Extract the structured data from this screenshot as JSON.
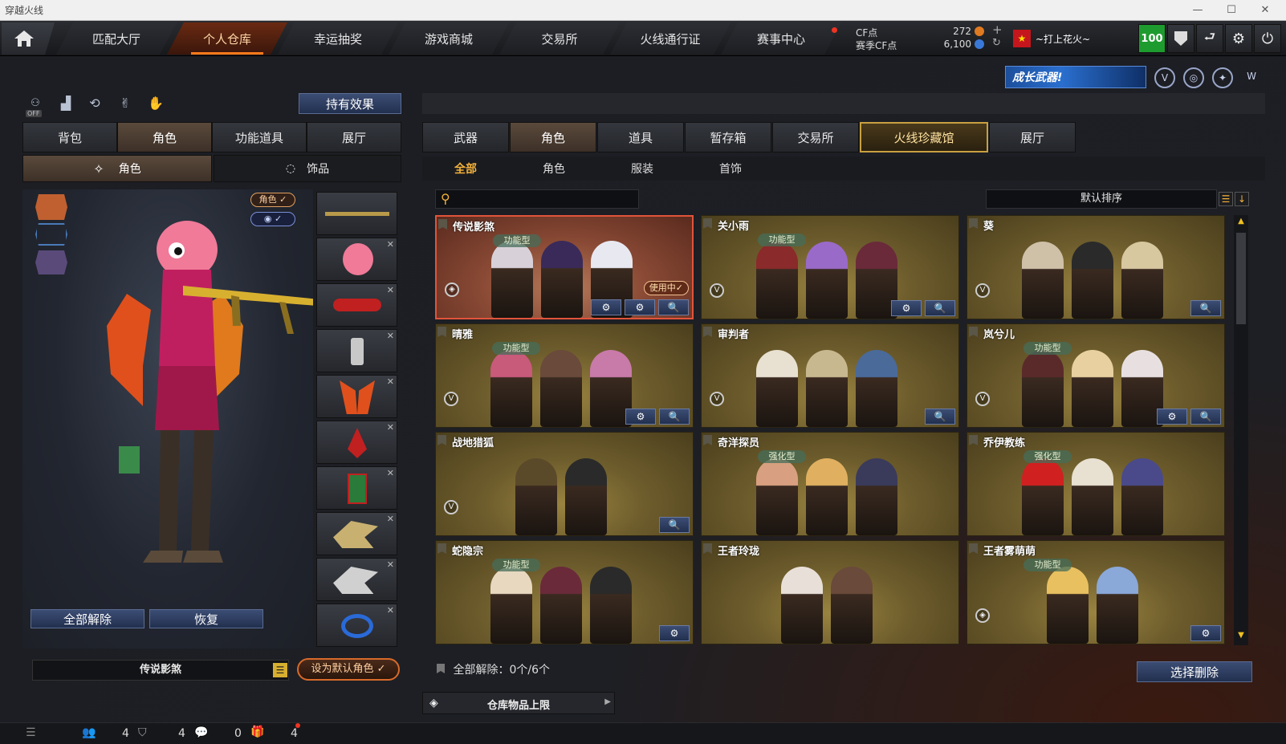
{
  "window": {
    "title": "穿越火线",
    "min": "—",
    "max": "☐",
    "close": "✕"
  },
  "nav": {
    "home_icon": "home-icon",
    "tabs": [
      "匹配大厅",
      "个人仓库",
      "幸运抽奖",
      "游戏商城",
      "交易所",
      "火线通行证",
      "赛事中心"
    ],
    "active": "个人仓库"
  },
  "currency": {
    "cf_label": "CF点",
    "cf_value": "272",
    "season_label": "赛季CF点",
    "season_value": "6,100"
  },
  "user": {
    "flag": "★",
    "name": "~打上花火~",
    "level": "100"
  },
  "banner": {
    "text": "成长武器!"
  },
  "left": {
    "hold_effect": "持有效果",
    "off_label": "OFF",
    "tabs": [
      "背包",
      "角色",
      "功能道具",
      "展厅"
    ],
    "active_tab": "角色",
    "subtabs": [
      "角色",
      "饰品"
    ],
    "tag_role": "角色 ✓",
    "tag_eye": "◉ ✓",
    "unequip_all": "全部解除",
    "restore": "恢复",
    "current_role": "传说影煞",
    "set_default": "设为默认角色 ✓"
  },
  "right": {
    "tabs": [
      "武器",
      "角色",
      "道具",
      "暂存箱",
      "交易所",
      "火线珍藏馆",
      "展厅"
    ],
    "active_tab": "角色",
    "highlight_tab": "火线珍藏馆",
    "subtabs": [
      "全部",
      "角色",
      "服装",
      "首饰"
    ],
    "active_subtab": "全部",
    "search_placeholder": "",
    "sort_label": "默认排序",
    "cards": [
      {
        "name": "传说影煞",
        "type": "功能型",
        "using": "使用中✓",
        "btns": [
          "⚙",
          "⚙",
          "🔍"
        ],
        "badge": "◈"
      },
      {
        "name": "关小雨",
        "type": "功能型",
        "btns": [
          "⚙",
          "🔍"
        ],
        "badge": "V"
      },
      {
        "name": "葵",
        "type": "",
        "btns": [
          "🔍"
        ],
        "badge": "V"
      },
      {
        "name": "晴雅",
        "type": "功能型",
        "btns": [
          "⚙",
          "🔍"
        ],
        "badge": "V"
      },
      {
        "name": "审判者",
        "type": "",
        "btns": [
          "🔍"
        ],
        "badge": "V"
      },
      {
        "name": "岚兮儿",
        "type": "功能型",
        "btns": [
          "⚙",
          "🔍"
        ],
        "badge": "V"
      },
      {
        "name": "战地猎狐",
        "type": "",
        "btns": [
          "🔍"
        ],
        "badge": "V"
      },
      {
        "name": "奇洋探员",
        "type": "强化型",
        "btns": [],
        "badge": ""
      },
      {
        "name": "乔伊教练",
        "type": "强化型",
        "btns": [],
        "badge": ""
      },
      {
        "name": "蛇隐宗",
        "type": "功能型",
        "btns": [
          "⚙"
        ],
        "badge": ""
      },
      {
        "name": "王者玲珑",
        "type": "",
        "btns": [],
        "badge": ""
      },
      {
        "name": "王者雾萌萌",
        "type": "功能型",
        "btns": [
          "⚙"
        ],
        "badge": "◈"
      }
    ],
    "unequip_status": "全部解除：0个/6个",
    "delete_select": "选择删除",
    "storage_limit": "仓库物品上限"
  },
  "statusbar": {
    "c1": "4",
    "c2": "4",
    "c3": "0",
    "c4": "4"
  }
}
